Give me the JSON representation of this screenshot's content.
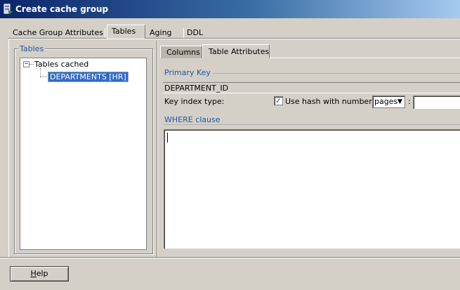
{
  "window": {
    "title": "Create cache group"
  },
  "top_tabs": [
    {
      "label": "Cache Group Attributes",
      "selected": false
    },
    {
      "label": "Tables",
      "selected": true
    },
    {
      "label": "Aging",
      "selected": false
    },
    {
      "label": "DDL",
      "selected": false
    }
  ],
  "tables_panel": {
    "group_label": "Tables",
    "tree": {
      "expander": "−",
      "root_label": "Tables cached",
      "child_label": "DEPARTMENTS [HR]"
    }
  },
  "inner_tabs": [
    {
      "label": "Columns",
      "selected": false
    },
    {
      "label": "Table Attributes",
      "selected": true
    }
  ],
  "primary_key": {
    "section_label": "Primary Key",
    "value": "DEPARTMENT_ID"
  },
  "key_index": {
    "label": "Key index type:",
    "checkbox_label": "Use hash with number of",
    "checked": true,
    "select_value": "pages",
    "separator": ":",
    "number_value": ""
  },
  "where_clause": {
    "section_label": "WHERE clause",
    "value": ""
  },
  "footer": {
    "help_label": "Help"
  },
  "colors": {
    "title_bar_start": "#0a246a",
    "title_bar_end": "#a6caf0",
    "section_label": "#2155a6",
    "selection": "#316ac5",
    "dialog_bg": "#d4d0c8"
  }
}
